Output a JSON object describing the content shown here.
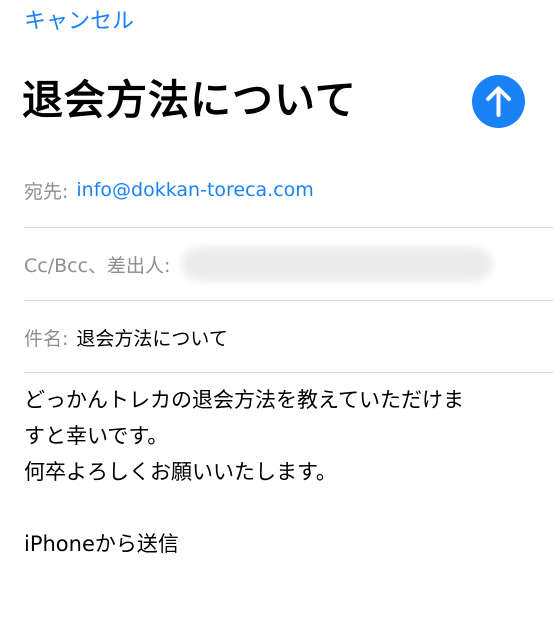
{
  "header": {
    "cancel_label": "キャンセル",
    "title": "退会方法について",
    "send_icon": "arrow-up-icon"
  },
  "fields": {
    "to": {
      "label": "宛先:",
      "value": "info@dokkan-toreca.com"
    },
    "cc_bcc": {
      "label": "Cc/Bcc、差出人:",
      "value_hidden": true
    },
    "subject": {
      "label": "件名:",
      "value": "退会方法について"
    }
  },
  "body": {
    "lines": [
      "どっかんトレカの退会方法を教えていただけま",
      "すと幸いです。",
      "何卒よろしくお願いいたします。",
      "",
      "iPhoneから送信"
    ]
  },
  "colors": {
    "accent": "#1a82f7",
    "label_gray": "#8e8e93",
    "separator": "#d9d9dc"
  }
}
